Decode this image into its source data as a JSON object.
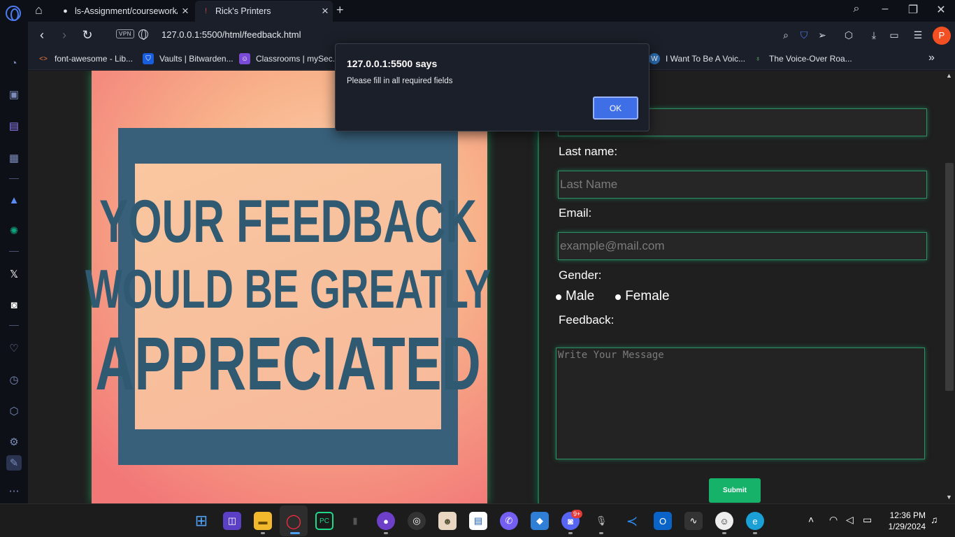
{
  "tabs": [
    {
      "label": "ls-Assignment/coursework/",
      "active": false
    },
    {
      "label": "Rick's Printers",
      "active": true
    }
  ],
  "address": {
    "vpn": "VPN",
    "url": "127.0.0.1:5500/html/feedback.html"
  },
  "profile_initial": "P",
  "bookmarks": [
    {
      "label": "font-awesome - Lib...",
      "icon": "code-icon"
    },
    {
      "label": "Vaults | Bitwarden...",
      "icon": "bitwarden-icon"
    },
    {
      "label": "Classrooms | mySec...",
      "icon": "classroom-icon"
    },
    {
      "label": "I Want To Be A Voic...",
      "icon": "wordpress-icon"
    },
    {
      "label": "The Voice-Over Roa...",
      "icon": "bulb-icon"
    }
  ],
  "hero": {
    "line1": "YOUR FEEDBACK",
    "line2": "WOULD BE GREATLY",
    "line3": "APPRECIATED"
  },
  "form": {
    "last_name_label": "Last name:",
    "last_name_placeholder": "Last Name",
    "email_label": "Email:",
    "email_placeholder": "example@mail.com",
    "gender_label": "Gender:",
    "gender_options": [
      "Male",
      "Female"
    ],
    "feedback_label": "Feedback:",
    "message_placeholder": "Write Your Message",
    "submit_label": "Submit"
  },
  "dialog": {
    "title": "127.0.0.1:5500 says",
    "message": "Please fill in all required fields",
    "ok_label": "OK"
  },
  "taskbar": {
    "time": "12:36 PM",
    "date": "1/29/2024",
    "discord_badge": "9+"
  },
  "colors": {
    "accent_green": "#17b26a",
    "field_border": "#2f8f64",
    "dialog_button": "#3f6fe6",
    "hero_text": "#2f5a72"
  }
}
